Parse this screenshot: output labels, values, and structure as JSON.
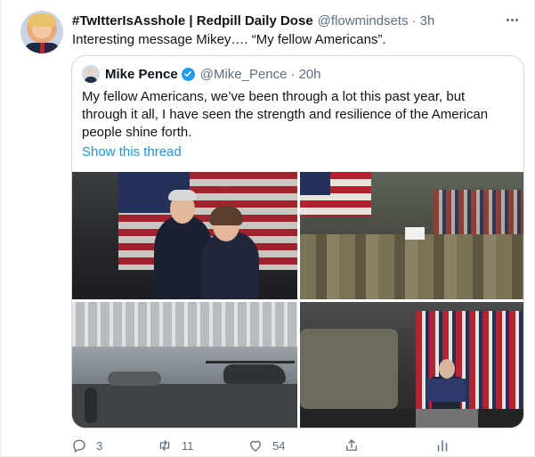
{
  "tweet": {
    "display_name": "#TwItterIsAsshole | Redpill Daily Dose",
    "handle": "@flowmindsets",
    "dot": "·",
    "time": "3h",
    "text": "Interesting message Mikey…. “My fellow Americans”."
  },
  "quoted": {
    "display_name": "Mike Pence",
    "handle": "@Mike_Pence",
    "dot": "·",
    "time": "20h",
    "text": "My fellow Americans, we’ve been through a lot this past year, but through it all, I have seen the strength and resilience of the American people shine forth.",
    "show_thread": "Show this thread",
    "accent_color": "#1b95e0"
  },
  "actions": {
    "reply_count": "3",
    "retweet_count": "11",
    "like_count": "54"
  },
  "icons": [
    "more-icon",
    "verified-icon",
    "reply-icon",
    "retweet-icon",
    "like-icon",
    "share-icon",
    "analytics-icon"
  ]
}
